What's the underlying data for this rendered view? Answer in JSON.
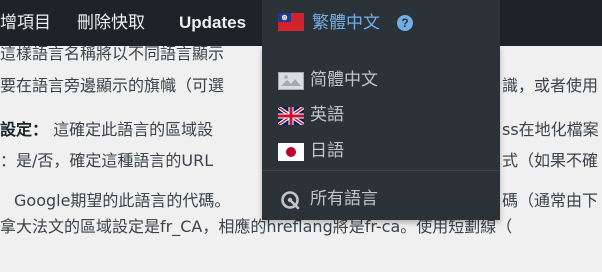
{
  "admin_bar": {
    "items": [
      {
        "label": "增項目"
      },
      {
        "label": "刪除快取"
      },
      {
        "label": "Updates"
      }
    ],
    "language_switcher": {
      "current_label": "繁體中文",
      "flag_icon": "taiwan-flag-icon",
      "help_icon": "question-circle-icon",
      "help_symbol": "?"
    }
  },
  "language_menu": {
    "items": [
      {
        "label": "简體中文",
        "icon": "china-flag-placeholder-icon"
      },
      {
        "label": "英語",
        "icon": "uk-flag-icon"
      },
      {
        "label": "日語",
        "icon": "japan-flag-icon"
      }
    ],
    "all_languages": {
      "label": "所有語言",
      "icon": "language-globe-icon"
    }
  },
  "page_text": {
    "line1": "這樣語言名稱將以不同語言顯示",
    "line2a": "要在語言旁邊顯示的旗幟（可選",
    "line2b": "識，或者使用",
    "line3_label": "設定：",
    "line3a": "這確定此語言的區域設",
    "line3b": "ss在地化檔案",
    "line4a": "：是/否，確定這種語言的URL",
    "line4b": "式（如果不確",
    "line5a": "Google期望的此語言的代碼。",
    "line5b": "碼（通常由下",
    "line6": "拿大法文的區域設定是fr_CA，相應的hreflang將是fr-ca。使用短劃線（"
  },
  "colors": {
    "admin_bar_bg": "#1d2327",
    "admin_bar_hover_bg": "#2c3338",
    "link_blue": "#72aee6",
    "menu_text": "#c3c4c7",
    "page_bg": "#f0f0f1",
    "body_text": "#3c434a"
  }
}
